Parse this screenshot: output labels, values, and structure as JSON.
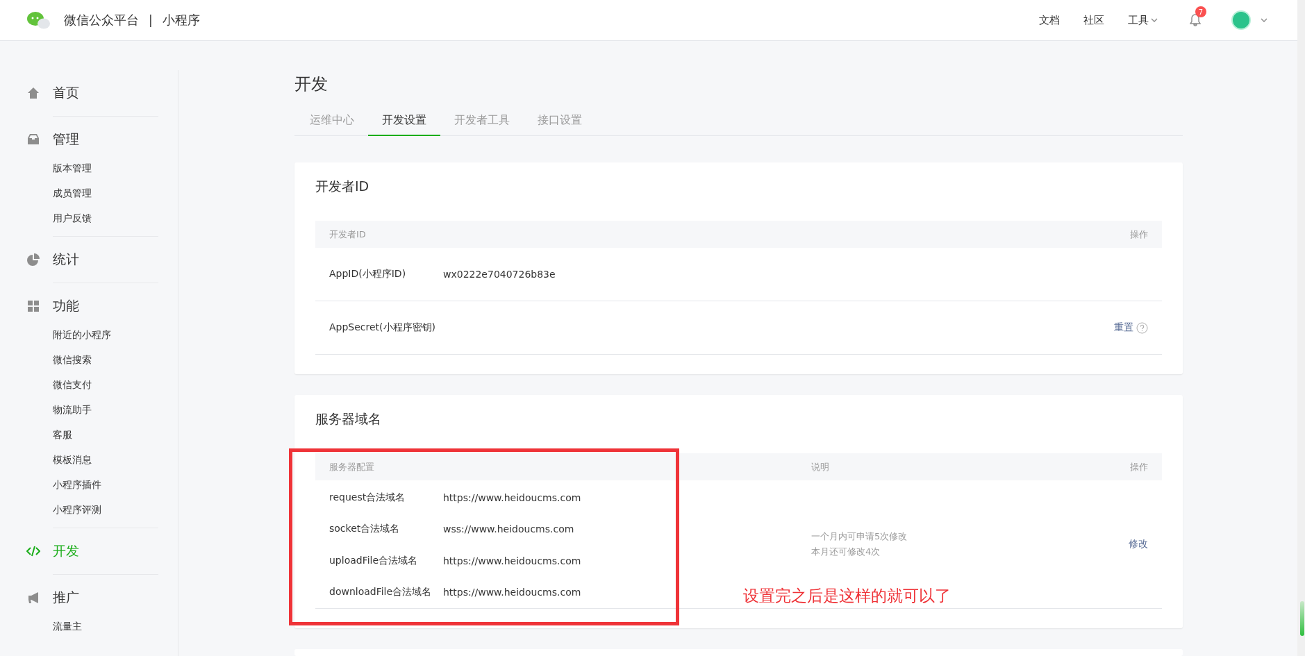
{
  "header": {
    "title": "微信公众平台",
    "separator": "|",
    "subtitle": "小程序",
    "nav": [
      {
        "label": "文档",
        "dropdown": false
      },
      {
        "label": "社区",
        "dropdown": false
      },
      {
        "label": "工具",
        "dropdown": true
      }
    ],
    "notification_count": "7"
  },
  "sidebar": {
    "groups": [
      {
        "label": "首页",
        "selected": false
      },
      {
        "label": "管理",
        "selected": false,
        "children": [
          {
            "label": "版本管理"
          },
          {
            "label": "成员管理"
          },
          {
            "label": "用户反馈"
          }
        ]
      },
      {
        "label": "统计",
        "selected": false
      },
      {
        "label": "功能",
        "selected": false,
        "children": [
          {
            "label": "附近的小程序"
          },
          {
            "label": "微信搜索"
          },
          {
            "label": "微信支付"
          },
          {
            "label": "物流助手"
          },
          {
            "label": "客服"
          },
          {
            "label": "模板消息"
          },
          {
            "label": "小程序插件"
          },
          {
            "label": "小程序评测"
          }
        ]
      },
      {
        "label": "开发",
        "selected": true
      },
      {
        "label": "推广",
        "selected": false,
        "children": [
          {
            "label": "流量主"
          }
        ]
      }
    ]
  },
  "page_title": "开发",
  "tabs": [
    {
      "label": "运维中心",
      "selected": false
    },
    {
      "label": "开发设置",
      "selected": true
    },
    {
      "label": "开发者工具",
      "selected": false
    },
    {
      "label": "接口设置",
      "selected": false
    }
  ],
  "developer_id_card": {
    "title": "开发者ID",
    "columns": [
      "开发者ID",
      "操作"
    ],
    "rows": [
      {
        "label": "AppID(小程序ID)",
        "value": "wx0222e7040726b83e"
      },
      {
        "label": "AppSecret(小程序密钥)",
        "action": "重置"
      }
    ]
  },
  "server_domain_card": {
    "title": "服务器域名",
    "columns": [
      "服务器配置",
      "说明",
      "操作"
    ],
    "rows": [
      {
        "label": "request合法域名",
        "value": "https://www.heidoucms.com"
      },
      {
        "label": "socket合法域名",
        "value": "wss://www.heidoucms.com"
      },
      {
        "label": "uploadFile合法域名",
        "value": "https://www.heidoucms.com"
      },
      {
        "label": "downloadFile合法域名",
        "value": "https://www.heidoucms.com"
      }
    ],
    "notes": [
      "一个月内可申请5次修改",
      "本月还可修改4次"
    ],
    "action": "修改"
  },
  "annotation": {
    "text": "设置完之后是这样的就可以了"
  }
}
